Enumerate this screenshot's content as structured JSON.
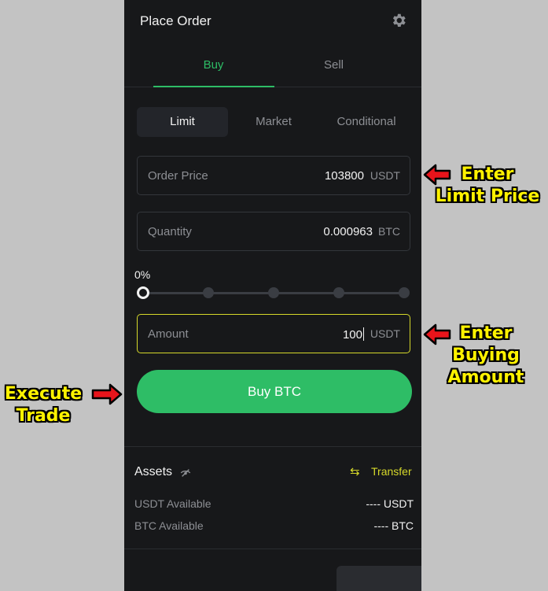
{
  "order_panel": {
    "title": "Place Order",
    "settings_icon": "gear-icon",
    "side_tabs": [
      {
        "label": "Buy",
        "active": true
      },
      {
        "label": "Sell",
        "active": false
      }
    ],
    "order_types": [
      {
        "label": "Limit",
        "active": true
      },
      {
        "label": "Market",
        "active": false
      },
      {
        "label": "Conditional",
        "active": false
      }
    ],
    "price_field": {
      "label": "Order Price",
      "value": "103800",
      "unit": "USDT"
    },
    "quantity_field": {
      "label": "Quantity",
      "value": "0.000963",
      "unit": "BTC"
    },
    "slider": {
      "percent_label": "0%",
      "value_percent": 0,
      "stops_percent": [
        0,
        25,
        50,
        75,
        100
      ]
    },
    "amount_field": {
      "label": "Amount",
      "value": "100",
      "unit": "USDT",
      "focused": true
    },
    "buy_button": {
      "label": "Buy BTC"
    }
  },
  "assets": {
    "title": "Assets",
    "visibility_icon": "eye-off-icon",
    "transfer_icon": "swap-arrows-icon",
    "transfer_label": "Transfer",
    "rows": [
      {
        "label": "USDT Available",
        "value": "---- USDT"
      },
      {
        "label": "BTC Available",
        "value": "---- BTC"
      }
    ]
  },
  "annotations": {
    "limit_price": [
      "Enter",
      "Limit Price"
    ],
    "buying_amount": [
      "Enter",
      "Buying",
      "Amount"
    ],
    "execute_trade": [
      "Execute",
      "Trade"
    ]
  },
  "colors": {
    "buy_green": "#2ebd66",
    "accent_yellow": "#d6d92a",
    "panel_bg": "#17181a",
    "page_bg": "#c3c3c3",
    "annotation_yellow": "#fff200",
    "annotation_arrow": "#e8141b"
  }
}
